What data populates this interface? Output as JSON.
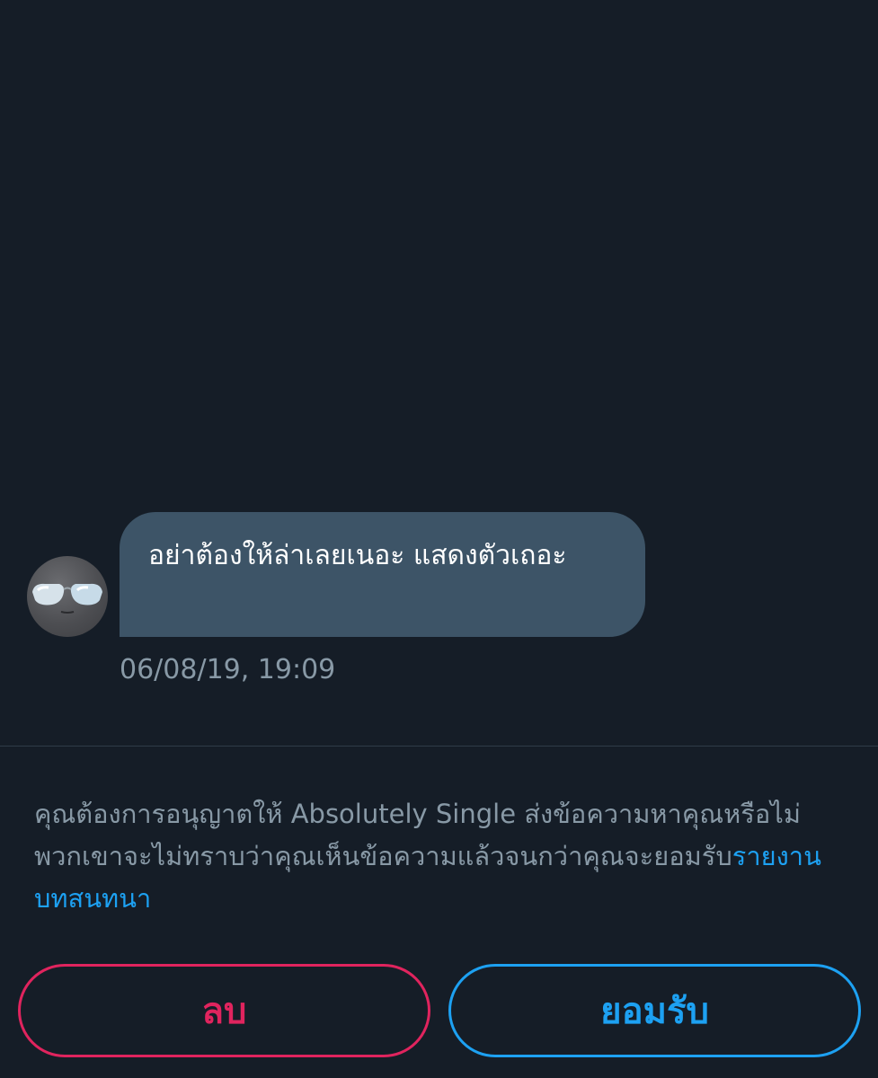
{
  "message": {
    "text": "อย่าต้องให้ล่าเลยเนอะ แสดงตัวเถอะ",
    "timestamp": "06/08/19, 19:09",
    "avatar_icon": "sunglasses-avatar-icon"
  },
  "request": {
    "prompt_text": "คุณต้องการอนุญาตให้ Absolutely Single ส่งข้อความหาคุณหรือไม่ พวกเขาจะไม่ทราบว่าคุณเห็นข้อความแล้วจนกว่าคุณจะยอมรับ",
    "report_link": "รายงานบทสนทนา"
  },
  "actions": {
    "delete_label": "ลบ",
    "accept_label": "ยอมรับ"
  },
  "colors": {
    "background": "#151d27",
    "bubble": "#3d5467",
    "secondary_text": "#8899a6",
    "delete": "#e0245e",
    "accept": "#1da1f2"
  }
}
